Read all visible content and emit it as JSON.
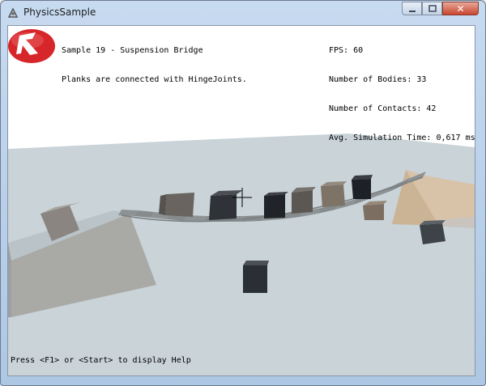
{
  "window": {
    "title": "PhysicsSample",
    "min_icon": "minimize-icon",
    "max_icon": "maximize-icon",
    "close_icon": "close-icon"
  },
  "sample": {
    "title": "Sample 19 - Suspension Bridge",
    "description": "Planks are connected with HingeJoints."
  },
  "stats": {
    "fps": "FPS: 60",
    "bodies": "Number of Bodies: 33",
    "contacts": "Number of Contacts: 42",
    "sim_time": "Avg. Simulation Time: 0,617 ms"
  },
  "help_text": "Press <F1> or <Start> to display Help",
  "colors": {
    "floor": "#c8d2d7",
    "sky": "#ffffff",
    "logo": "#d6262a"
  }
}
